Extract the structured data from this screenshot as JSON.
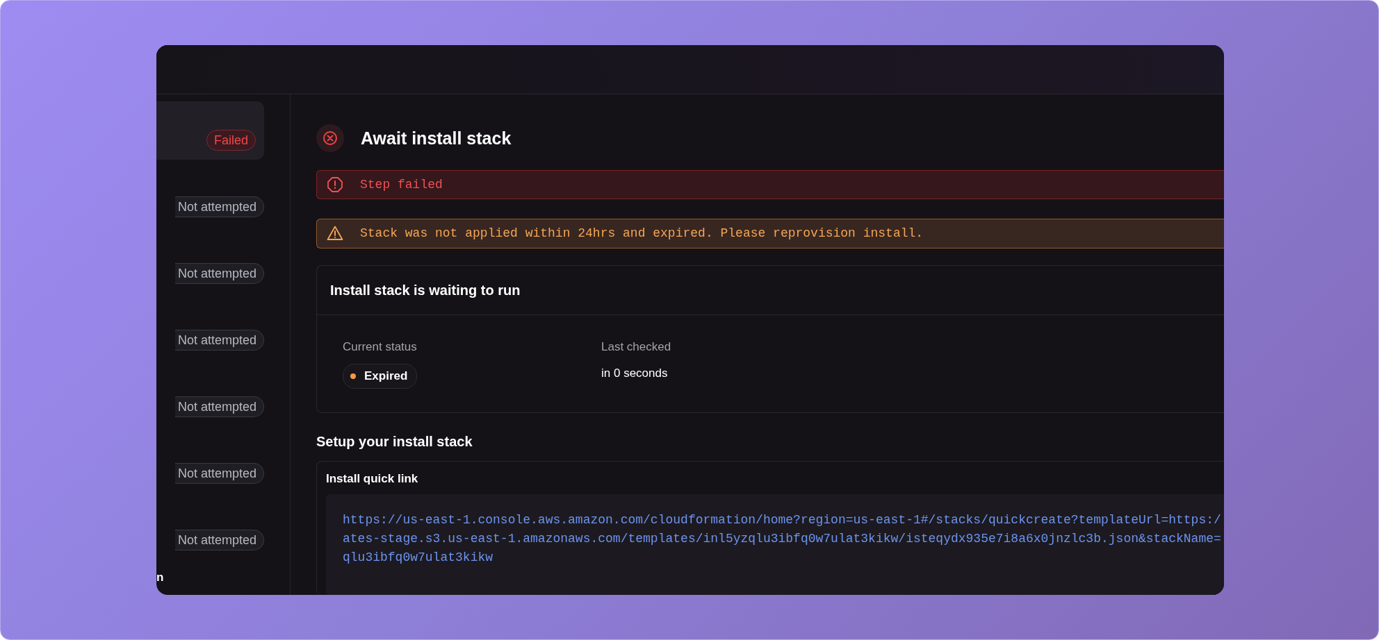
{
  "sidebar": {
    "items": [
      {
        "badge": "Failed",
        "kind": "failed",
        "selected": true
      },
      {
        "badge": "Not attempted",
        "kind": "not_attempted",
        "selected": false
      },
      {
        "badge": "Not attempted",
        "kind": "not_attempted",
        "selected": false
      },
      {
        "badge": "Not attempted",
        "kind": "not_attempted",
        "selected": false
      },
      {
        "badge": "Not attempted",
        "kind": "not_attempted",
        "selected": false
      },
      {
        "badge": "Not attempted",
        "kind": "not_attempted",
        "selected": false
      },
      {
        "badge": "Not attempted",
        "kind": "not_attempted",
        "selected": false
      }
    ],
    "section_label": "n"
  },
  "step": {
    "title": "Await install stack"
  },
  "alerts": [
    {
      "kind": "error",
      "text": "Step failed"
    },
    {
      "kind": "warning",
      "text": "Stack was not applied within 24hrs and expired. Please reprovision install."
    }
  ],
  "status_card": {
    "title": "Install stack is waiting to run",
    "current_status": {
      "label": "Current status",
      "value": "Expired"
    },
    "last_checked": {
      "label": "Last checked",
      "value": "in 0 seconds"
    }
  },
  "setup": {
    "title": "Setup your install stack",
    "quick_link": {
      "title": "Install quick link",
      "lines": [
        "https://us-east-1.console.aws.amazon.com/cloudformation/home?region=us-east-1#/stacks/quickcreate?templateUrl=https:/",
        "ates-stage.s3.us-east-1.amazonaws.com/templates/inl5yzqlu3ibfq0w7ulat3kikw/isteqydx935e7i8a6x0jnzlc3b.json&stackName=",
        "qlu3ibfq0w7ulat3kikw"
      ]
    }
  }
}
